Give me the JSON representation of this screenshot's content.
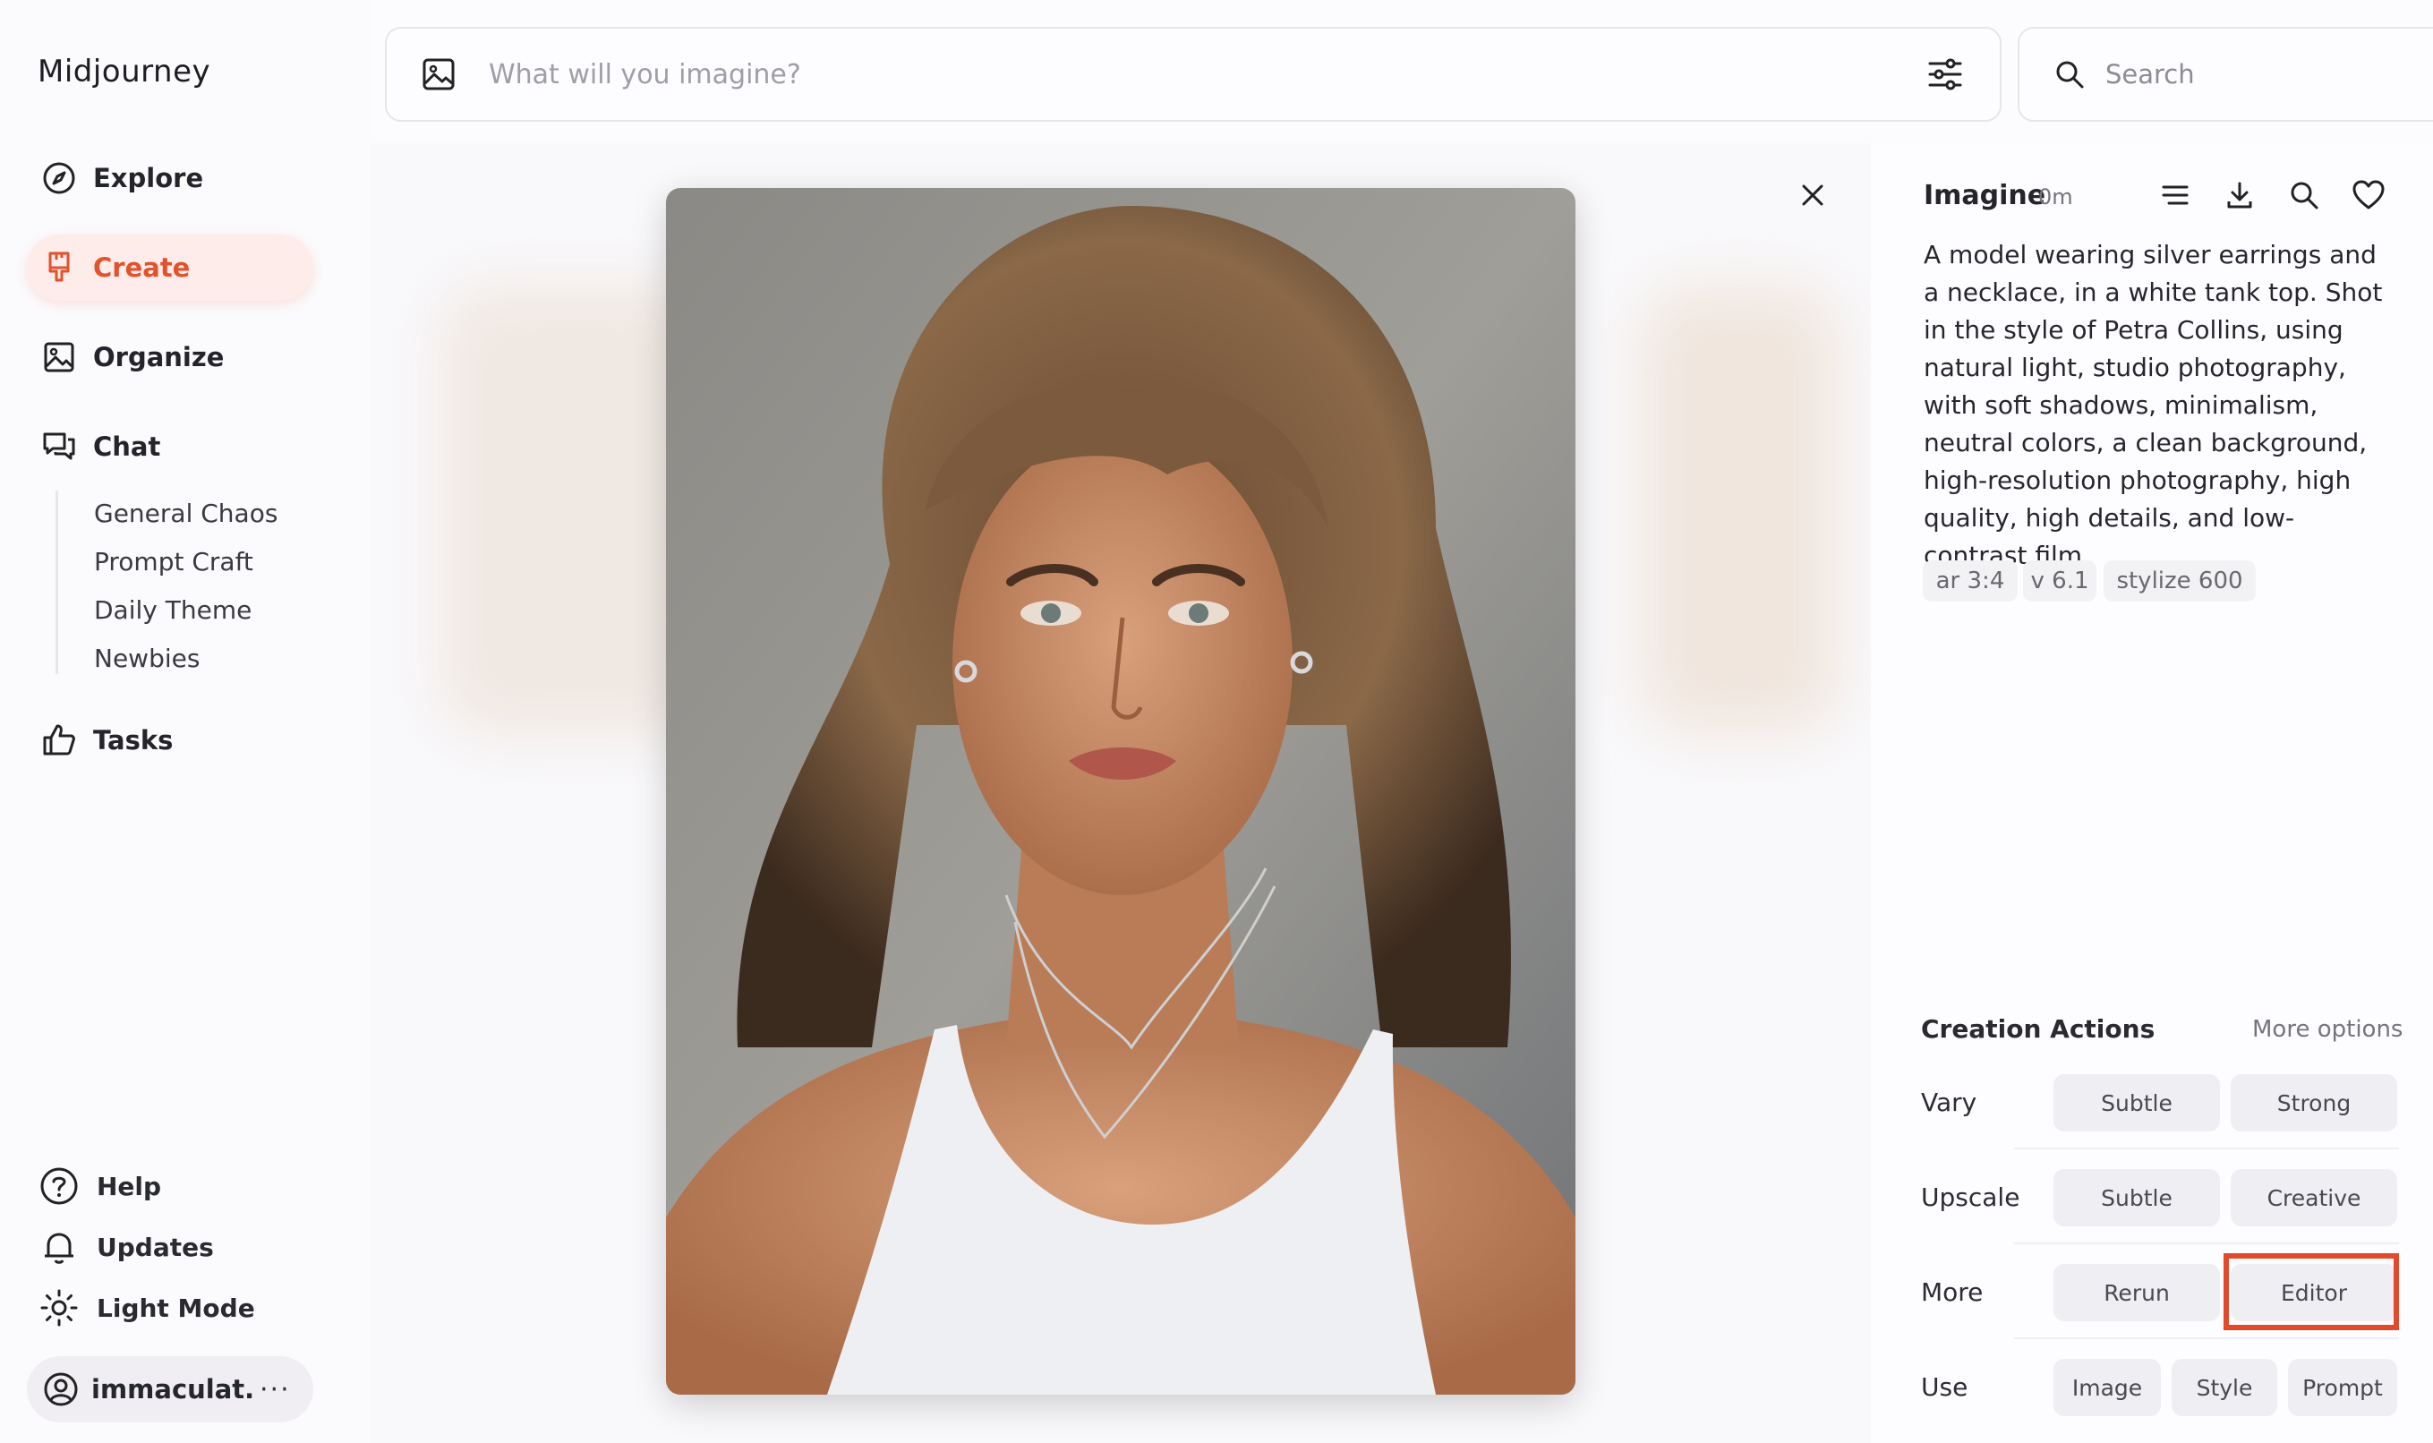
{
  "sidebar": {
    "brand": "Midjourney",
    "items": [
      {
        "label": "Explore",
        "icon": "compass-icon"
      },
      {
        "label": "Create",
        "icon": "paintbrush-icon",
        "active": true
      },
      {
        "label": "Organize",
        "icon": "image-gallery-icon"
      },
      {
        "label": "Chat",
        "icon": "chat-bubbles-icon"
      }
    ],
    "chat_channels": [
      "General Chaos",
      "Prompt Craft",
      "Daily Theme",
      "Newbies"
    ],
    "tasks": {
      "label": "Tasks",
      "icon": "thumbs-up-icon"
    },
    "bottom": [
      {
        "label": "Help",
        "icon": "question-icon"
      },
      {
        "label": "Updates",
        "icon": "bell-icon"
      },
      {
        "label": "Light Mode",
        "icon": "sun-icon"
      }
    ],
    "user": {
      "name": "immaculat...",
      "more": "···"
    }
  },
  "prompt_bar": {
    "placeholder": "What will you imagine?"
  },
  "search": {
    "placeholder": "Search"
  },
  "viewer": {
    "close_icon": "close-icon"
  },
  "details": {
    "title": "Imagine",
    "time": "0m",
    "prompt": "A model wearing silver earrings and a necklace, in a white tank top. Shot in the style of Petra Collins, using natural light, studio photography, with soft shadows, minimalism, neutral colors, a clean background, high-resolution photography, high quality, high details, and low-contrast film.",
    "chips": [
      "ar 3:4",
      "v 6.1",
      "stylize 600"
    ]
  },
  "actions": {
    "title": "Creation Actions",
    "more": "More options",
    "rows": [
      {
        "label": "Vary",
        "buttons": [
          "Subtle",
          "Strong"
        ]
      },
      {
        "label": "Upscale",
        "buttons": [
          "Subtle",
          "Creative"
        ]
      },
      {
        "label": "More",
        "buttons": [
          "Rerun",
          "Editor"
        ]
      },
      {
        "label": "Use",
        "buttons": [
          "Image",
          "Style",
          "Prompt"
        ]
      }
    ]
  },
  "colors": {
    "accent": "#e2522c",
    "highlight_box": "#e24a2b"
  }
}
